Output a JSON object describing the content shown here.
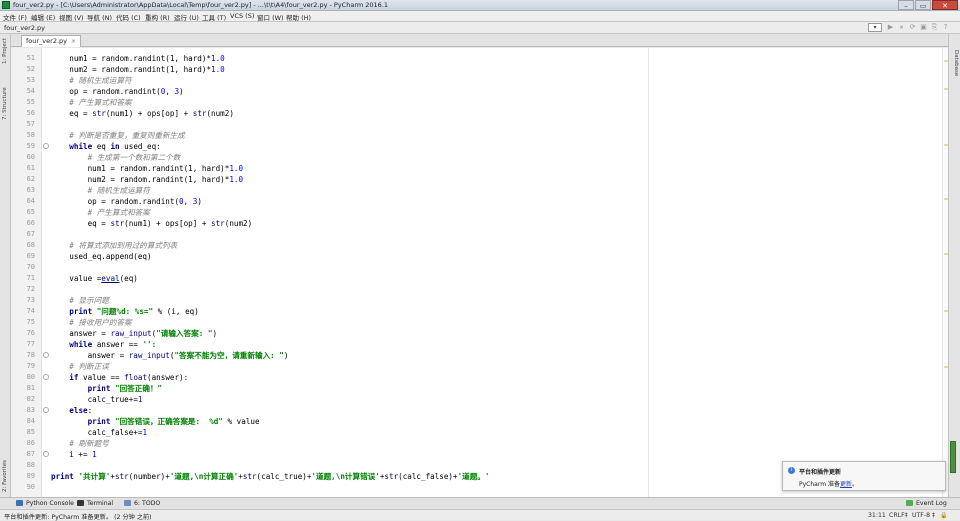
{
  "window": {
    "title": "four_ver2.py - [C:\\Users\\Administrator\\AppData\\Local\\Temp\\four_ver2.py] - ...\\t\\t\\A4\\four_ver2.py - PyCharm 2016.1",
    "controls": [
      "–",
      "▭",
      "✕"
    ]
  },
  "menu": [
    "文件 (F)",
    "编辑 (E)",
    "视图 (V)",
    "导航 (N)",
    "代码 (C)",
    "重构 (R)",
    "运行 (U)",
    "工具 (T)",
    "VCS (S)",
    "窗口 (W)",
    "帮助 (H)"
  ],
  "breadcrumb": "four_ver2.py",
  "toolbar": {
    "config_select": "▾",
    "icons": [
      "▶",
      "⏸",
      "⟳",
      "▣",
      "⎘",
      "?"
    ]
  },
  "tab": {
    "label": "four_ver2.py",
    "close": "×"
  },
  "left_tool_tabs": [
    "1: Project",
    "7: Structure",
    "2: Favorites"
  ],
  "right_tool_tabs": [
    "Database"
  ],
  "code": {
    "line_numbers": [
      "51",
      "52",
      "53",
      "54",
      "55",
      "56",
      "57",
      "58",
      "59",
      "60",
      "61",
      "62",
      "63",
      "64",
      "65",
      "66",
      "67",
      "68",
      "69",
      "70",
      "71",
      "72",
      "73",
      "74",
      "75",
      "76",
      "77",
      "78",
      "79",
      "80",
      "81",
      "82",
      "83",
      "84",
      "85",
      "86",
      "87",
      "88",
      "89",
      "90"
    ],
    "lines": [
      [
        {
          "t": "    num1 = random.randint(1, hard)*",
          "c": ""
        },
        {
          "t": "1.0",
          "c": "nm"
        }
      ],
      [
        {
          "t": "    num2 = random.randint(1, hard)*",
          "c": ""
        },
        {
          "t": "1.0",
          "c": "nm"
        }
      ],
      [
        {
          "t": "    # 随机生成运算符",
          "c": "cm"
        }
      ],
      [
        {
          "t": "    op = random.randint(",
          "c": ""
        },
        {
          "t": "0",
          "c": "nm"
        },
        {
          "t": ", ",
          "c": ""
        },
        {
          "t": "3",
          "c": "nm"
        },
        {
          "t": ")",
          "c": ""
        }
      ],
      [
        {
          "t": "    # 产生算式和答案",
          "c": "cm"
        }
      ],
      [
        {
          "t": "    eq = ",
          "c": ""
        },
        {
          "t": "str",
          "c": "fn"
        },
        {
          "t": "(num1) + ops[op] + ",
          "c": ""
        },
        {
          "t": "str",
          "c": "fn"
        },
        {
          "t": "(num2)",
          "c": ""
        }
      ],
      [
        {
          "t": "",
          "c": ""
        }
      ],
      [
        {
          "t": "    # 判断是否重复，重复则重新生成",
          "c": "cm"
        }
      ],
      [
        {
          "t": "    ",
          "c": ""
        },
        {
          "t": "while",
          "c": "kw"
        },
        {
          "t": " eq ",
          "c": ""
        },
        {
          "t": "in",
          "c": "kw"
        },
        {
          "t": " used_eq:",
          "c": ""
        }
      ],
      [
        {
          "t": "        # 生成第一个数和第二个数",
          "c": "cm"
        }
      ],
      [
        {
          "t": "        num1 = random.randint(1, hard)*",
          "c": ""
        },
        {
          "t": "1.0",
          "c": "nm"
        }
      ],
      [
        {
          "t": "        num2 = random.randint(1, hard)*",
          "c": ""
        },
        {
          "t": "1.0",
          "c": "nm"
        }
      ],
      [
        {
          "t": "        # 随机生成运算符",
          "c": "cm"
        }
      ],
      [
        {
          "t": "        op = random.randint(",
          "c": ""
        },
        {
          "t": "0",
          "c": "nm"
        },
        {
          "t": ", ",
          "c": ""
        },
        {
          "t": "3",
          "c": "nm"
        },
        {
          "t": ")",
          "c": ""
        }
      ],
      [
        {
          "t": "        # 产生算式和答案",
          "c": "cm"
        }
      ],
      [
        {
          "t": "        eq = ",
          "c": ""
        },
        {
          "t": "str",
          "c": "fn"
        },
        {
          "t": "(num1) + ops[op] + ",
          "c": ""
        },
        {
          "t": "str",
          "c": "fn"
        },
        {
          "t": "(num2)",
          "c": ""
        }
      ],
      [
        {
          "t": "",
          "c": ""
        }
      ],
      [
        {
          "t": "    # 将算式添加到用过的算式列表",
          "c": "cm"
        }
      ],
      [
        {
          "t": "    used_eq.append(eq)",
          "c": ""
        }
      ],
      [
        {
          "t": "",
          "c": ""
        }
      ],
      [
        {
          "t": "    value =",
          "c": ""
        },
        {
          "t": "eval",
          "c": "bi"
        },
        {
          "t": "(eq)",
          "c": ""
        }
      ],
      [
        {
          "t": "",
          "c": ""
        }
      ],
      [
        {
          "t": "    # 显示问题",
          "c": "cm"
        }
      ],
      [
        {
          "t": "    ",
          "c": ""
        },
        {
          "t": "print",
          "c": "kw"
        },
        {
          "t": " ",
          "c": ""
        },
        {
          "t": "\"问题%d: %s=\"",
          "c": "st"
        },
        {
          "t": " % (i, eq)",
          "c": ""
        }
      ],
      [
        {
          "t": "    # 接收用户的答案",
          "c": "cm"
        }
      ],
      [
        {
          "t": "    answer = ",
          "c": ""
        },
        {
          "t": "raw_input",
          "c": "fn"
        },
        {
          "t": "(",
          "c": ""
        },
        {
          "t": "\"请输入答案: \"",
          "c": "st"
        },
        {
          "t": ")",
          "c": ""
        }
      ],
      [
        {
          "t": "    ",
          "c": ""
        },
        {
          "t": "while",
          "c": "kw"
        },
        {
          "t": " answer == ",
          "c": ""
        },
        {
          "t": "'':",
          "c": "st"
        }
      ],
      [
        {
          "t": "        answer = ",
          "c": ""
        },
        {
          "t": "raw_input",
          "c": "fn"
        },
        {
          "t": "(",
          "c": ""
        },
        {
          "t": "\"答案不能为空，请重新输入: \"",
          "c": "st"
        },
        {
          "t": ")",
          "c": ""
        }
      ],
      [
        {
          "t": "    # 判断正误",
          "c": "cm"
        }
      ],
      [
        {
          "t": "    ",
          "c": ""
        },
        {
          "t": "if",
          "c": "kw"
        },
        {
          "t": " value == ",
          "c": ""
        },
        {
          "t": "float",
          "c": "fn"
        },
        {
          "t": "(answer):",
          "c": ""
        }
      ],
      [
        {
          "t": "        ",
          "c": ""
        },
        {
          "t": "print",
          "c": "kw"
        },
        {
          "t": " ",
          "c": ""
        },
        {
          "t": "\"回答正确！\"",
          "c": "st"
        }
      ],
      [
        {
          "t": "        calc_true+=",
          "c": ""
        },
        {
          "t": "1",
          "c": "nm"
        }
      ],
      [
        {
          "t": "    ",
          "c": ""
        },
        {
          "t": "else",
          "c": "kw"
        },
        {
          "t": ":",
          "c": ""
        }
      ],
      [
        {
          "t": "        ",
          "c": ""
        },
        {
          "t": "print",
          "c": "kw"
        },
        {
          "t": " ",
          "c": ""
        },
        {
          "t": "\"回答错误，正确答案是:  %d\"",
          "c": "st"
        },
        {
          "t": " % value",
          "c": ""
        }
      ],
      [
        {
          "t": "        calc_false+=",
          "c": ""
        },
        {
          "t": "1",
          "c": "nm"
        }
      ],
      [
        {
          "t": "    # 刷新题号",
          "c": "cm"
        }
      ],
      [
        {
          "t": "    i += ",
          "c": ""
        },
        {
          "t": "1",
          "c": "nm"
        }
      ],
      [
        {
          "t": "",
          "c": ""
        }
      ],
      [
        {
          "t": "print",
          "c": "kw"
        },
        {
          "t": " ",
          "c": ""
        },
        {
          "t": "'共计算'",
          "c": "st"
        },
        {
          "t": "+",
          "c": ""
        },
        {
          "t": "str",
          "c": "fn"
        },
        {
          "t": "(number)+",
          "c": ""
        },
        {
          "t": "'道题,\\n计算正确'",
          "c": "st"
        },
        {
          "t": "+",
          "c": ""
        },
        {
          "t": "str",
          "c": "fn"
        },
        {
          "t": "(calc_true)+",
          "c": ""
        },
        {
          "t": "'道题,\\n计算错误'",
          "c": "st"
        },
        {
          "t": "+",
          "c": ""
        },
        {
          "t": "str",
          "c": "fn"
        },
        {
          "t": "(calc_false)+",
          "c": ""
        },
        {
          "t": "'道题。'",
          "c": "st"
        }
      ],
      [
        {
          "t": "",
          "c": ""
        }
      ]
    ]
  },
  "notification": {
    "title": "平台和插件更新",
    "body": "PyCharm 准备",
    "link": "更新",
    "tail": "。"
  },
  "tool_windows": [
    "Python Console",
    "Terminal",
    "6: TODO",
    "Event Log"
  ],
  "status": {
    "message": "平台和插件更新: PyCharm 准备更新。 (2 分钟 之前)",
    "position": "31:11",
    "line_sep": "CRLF‡",
    "encoding": "UTF-8 ‡",
    "lock": "🔒"
  },
  "colors": {
    "keyword": "#000080",
    "string": "#008000",
    "number": "#0000ff",
    "comment": "#808080",
    "line_number": "#999999"
  }
}
